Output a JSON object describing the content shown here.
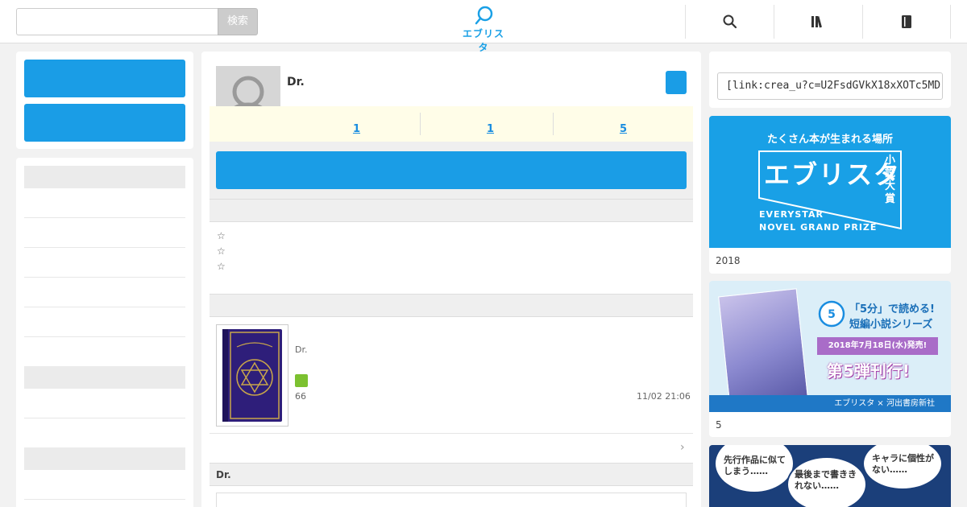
{
  "header": {
    "search_placeholder": "",
    "search_button": "検索",
    "logo_text": "エブリスタ",
    "nav_icons": [
      "search-icon",
      "library-icon",
      "book-icon"
    ]
  },
  "left": {
    "buttons": [
      "",
      ""
    ]
  },
  "profile": {
    "name": "Dr.",
    "stats": [
      "1",
      "1",
      "5"
    ],
    "stars": [
      "☆",
      "☆",
      "☆"
    ],
    "work": {
      "author": "Dr.",
      "count": "66",
      "updated": "11/02 21:06",
      "more_icon": "chevron-right-icon"
    },
    "section_footer_label": "Dr."
  },
  "right": {
    "link_field_value": "[link:crea_u?c=U2FsdGVkX18xXOTc5MD",
    "banners": [
      {
        "headline": "たくさん本が生まれる場所",
        "title": "エブリスタ",
        "tag": "小説大賞",
        "line1": "EVERYSTAR",
        "line2": "NOVEL GRAND PRIZE",
        "caption": "2018"
      },
      {
        "headline": "「5分」で読める!",
        "subline": "短編小説シリーズ",
        "date": "2018年7月18日(水)発売!",
        "tag": "第5弾刊行!",
        "footer": "エブリスタ × 河出書房新社",
        "caption": "5"
      },
      {
        "bubble1": "先行作品に似てしまう……",
        "bubble2": "最後まで書ききれない……",
        "bubble3": "キャラに個性がない……"
      }
    ]
  },
  "colors": {
    "accent": "#1a9de6",
    "stats_bg": "#fffde8",
    "badge": "#7cc130"
  }
}
